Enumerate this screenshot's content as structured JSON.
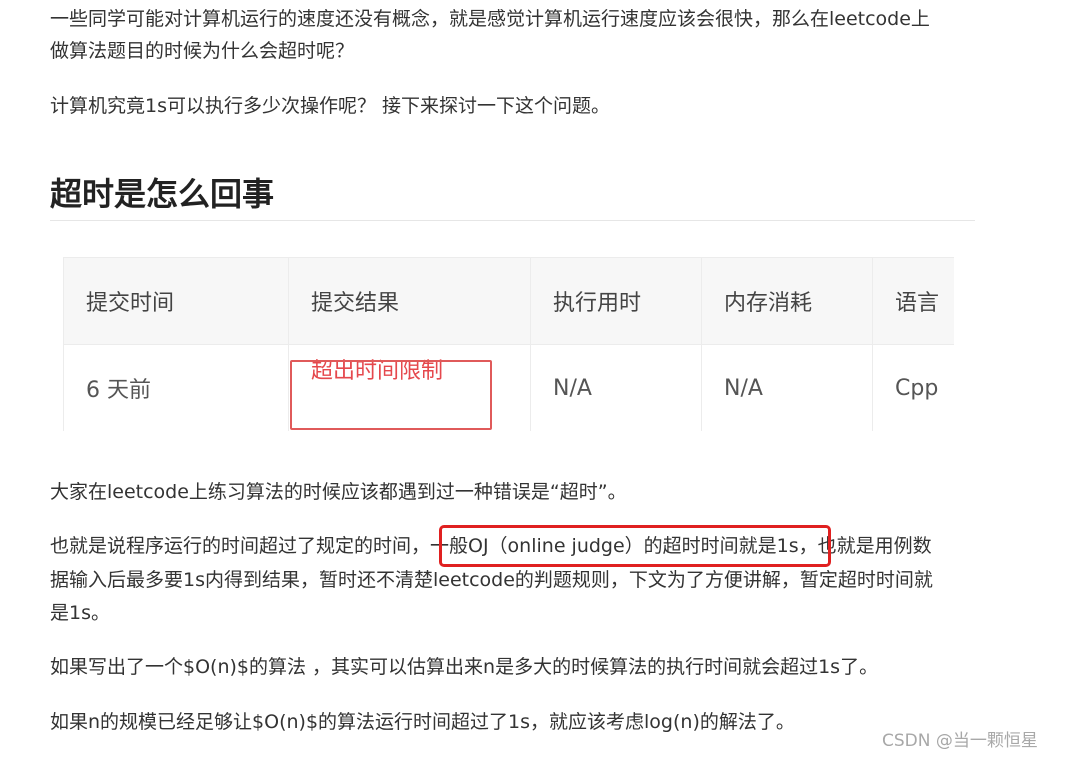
{
  "article": {
    "para1_line1": "一些同学可能对计算机运行的速度还没有概念，就是感觉计算机运行速度应该会很快，那么在leetcode上",
    "para1_line2": "做算法题目的时候为什么会超时呢？",
    "para2": "计算机究竟1s可以执行多少次操作呢？ 接下来探讨一下这个问题。",
    "heading": "超时是怎么回事",
    "para3": "大家在leetcode上练习算法的时候应该都遇到过一种错误是“超时”。",
    "para4_line1": "也就是说程序运行的时间超过了规定的时间，一般OJ（online judge）的超时时间就是1s，也就是用例数",
    "para4_line2": "据输入后最多要1s内得到结果，暂时还不清楚leetcode的判题规则，下文为了方便讲解，暂定超时时间就",
    "para4_line3": "是1s。",
    "para5": "如果写出了一个$O(n)$的算法 ，其实可以估算出来n是多大的时候算法的执行时间就会超过1s了。",
    "para6": "如果n的规模已经足够让$O(n)$的算法运行时间超过了1s，就应该考虑log(n)的解法了。"
  },
  "submission_table": {
    "headers": [
      "提交时间",
      "提交结果",
      "执行用时",
      "内存消耗",
      "语言"
    ],
    "row": [
      "6 天前",
      "超出时间限制",
      "N/A",
      "N/A",
      "Cpp"
    ]
  },
  "watermark": "CSDN @当一颗恒星",
  "colors": {
    "tle_red": "#e5484d",
    "highlight_box": "#e02020"
  }
}
